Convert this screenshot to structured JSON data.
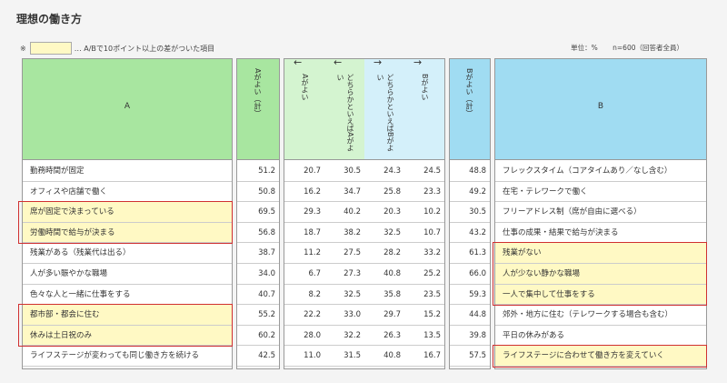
{
  "title": "理想の働き方",
  "legend": {
    "prefix": "※",
    "text": "… A/Bで10ポイント以上の差がついた項目"
  },
  "units": {
    "unit": "単位：%",
    "n": "n=600（回答者全員）"
  },
  "headers": {
    "a_label": "A",
    "b_label": "B",
    "a_total": "Aがよい（計）",
    "b_total": "Bがよい（計）",
    "cols": [
      {
        "arrow": "←",
        "text": "Aがよい"
      },
      {
        "arrow": "←",
        "text": "どちらかといえばAがよい"
      },
      {
        "arrow": "→",
        "text": "どちらかといえばBがよい"
      },
      {
        "arrow": "→",
        "text": "Bがよい"
      }
    ]
  },
  "colors": {
    "a_header": "#a8e6a0",
    "b_header": "#a0dcf2",
    "a_light": "#d4f4d0",
    "b_light": "#d4f0fa",
    "highlight": "#fff9c4",
    "box": "#d03030"
  },
  "chart_data": {
    "type": "table",
    "columns": [
      "Aがよい（計）",
      "Aがよい",
      "どちらかといえばAがよい",
      "どちらかといえばBがよい",
      "Bがよい",
      "Bがよい（計）"
    ],
    "rows": [
      {
        "a": "勤務時間が固定",
        "b": "フレックスタイム（コアタイムあり／なし含む）",
        "values": [
          "51.2",
          "20.7",
          "30.5",
          "24.3",
          "24.5",
          "48.8"
        ],
        "hl_a": false,
        "hl_b": false
      },
      {
        "a": "オフィスや店舗で働く",
        "b": "在宅・テレワークで働く",
        "values": [
          "50.8",
          "16.2",
          "34.7",
          "25.8",
          "23.3",
          "49.2"
        ],
        "hl_a": false,
        "hl_b": false
      },
      {
        "a": "席が固定で決まっている",
        "b": "フリーアドレス制（席が自由に選べる）",
        "values": [
          "69.5",
          "29.3",
          "40.2",
          "20.3",
          "10.2",
          "30.5"
        ],
        "hl_a": true,
        "hl_b": false
      },
      {
        "a": "労働時間で給与が決まる",
        "b": "仕事の成果・結果で給与が決まる",
        "values": [
          "56.8",
          "18.7",
          "38.2",
          "32.5",
          "10.7",
          "43.2"
        ],
        "hl_a": true,
        "hl_b": false
      },
      {
        "a": "残業がある（残業代は出る）",
        "b": "残業がない",
        "values": [
          "38.7",
          "11.2",
          "27.5",
          "28.2",
          "33.2",
          "61.3"
        ],
        "hl_a": false,
        "hl_b": true
      },
      {
        "a": "人が多い賑やかな職場",
        "b": "人が少ない静かな職場",
        "values": [
          "34.0",
          "6.7",
          "27.3",
          "40.8",
          "25.2",
          "66.0"
        ],
        "hl_a": false,
        "hl_b": true
      },
      {
        "a": "色々な人と一緒に仕事をする",
        "b": "一人で集中して仕事をする",
        "values": [
          "40.7",
          "8.2",
          "32.5",
          "35.8",
          "23.5",
          "59.3"
        ],
        "hl_a": false,
        "hl_b": true
      },
      {
        "a": "都市部・都会に住む",
        "b": "郊外・地方に住む（テレワークする場合も含む）",
        "values": [
          "55.2",
          "22.2",
          "33.0",
          "29.7",
          "15.2",
          "44.8"
        ],
        "hl_a": true,
        "hl_b": false
      },
      {
        "a": "休みは土日祝のみ",
        "b": "平日の休みがある",
        "values": [
          "60.2",
          "28.0",
          "32.2",
          "26.3",
          "13.5",
          "39.8"
        ],
        "hl_a": true,
        "hl_b": false
      },
      {
        "a": "ライフステージが変わっても同じ働き方を続ける",
        "b": "ライフステージに合わせて働き方を変えていく",
        "values": [
          "42.5",
          "11.0",
          "31.5",
          "40.8",
          "16.7",
          "57.5"
        ],
        "hl_a": false,
        "hl_b": true
      }
    ]
  }
}
